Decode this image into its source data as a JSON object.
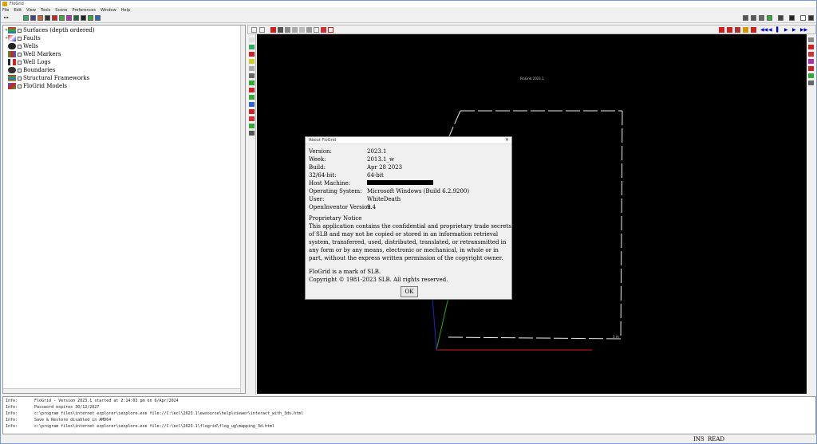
{
  "window": {
    "title": "FloGrid"
  },
  "menu": [
    "File",
    "Edit",
    "View",
    "Tools",
    "Scene",
    "Preferences",
    "Window",
    "Help"
  ],
  "tree": {
    "items": [
      {
        "label": "Surfaces (depth ordered)",
        "icon": "surfaces-icon",
        "expand": "+"
      },
      {
        "label": "Faults",
        "icon": "faults-icon",
        "expand": "+"
      },
      {
        "label": "Wells",
        "icon": "wells-icon",
        "expand": ""
      },
      {
        "label": "Well Markers",
        "icon": "well-markers-icon",
        "expand": ""
      },
      {
        "label": "Well Logs",
        "icon": "well-logs-icon",
        "expand": ""
      },
      {
        "label": "Boundaries",
        "icon": "boundaries-icon",
        "expand": ""
      },
      {
        "label": "Structural Frameworks",
        "icon": "structural-frameworks-icon",
        "expand": ""
      },
      {
        "label": "FloGrid Models",
        "icon": "flogrid-models-icon",
        "expand": ""
      }
    ]
  },
  "viewer": {
    "title": "FloGrid 2023.1",
    "corner_label": "3 m",
    "background": "#000000"
  },
  "about": {
    "title": "About FloGrid",
    "rows": [
      {
        "key": "Version:",
        "value": "2023.1"
      },
      {
        "key": "Week:",
        "value": "2013.1_w"
      },
      {
        "key": "Build:",
        "value": "Apr 28 2023"
      },
      {
        "key": "32/64-bit:",
        "value": "64-bit"
      },
      {
        "key": "Host Machine:",
        "value": ""
      },
      {
        "key": "Operating System:",
        "value": "Microsoft Windows (Build 6.2.9200)"
      },
      {
        "key": "User:",
        "value": "WhiteDeath"
      },
      {
        "key": "OpenInventor Version",
        "value": "9.4"
      }
    ],
    "notice_heading": "Proprietary Notice",
    "notice_body": "This application contains the confidential and proprietary trade secrets of SLB and may not be copied or stored in an information retrieval system, transferred, used, distributed, translated, or retransmitted in any form or by any means, electronic or mechanical, in whole or in part, without the express written permission of the copyright owner.",
    "trademark": "FloGrid is a mark of SLB.",
    "copyright": "Copyright © 1981-2023 SLB. All rights reserved.",
    "ok_label": "OK"
  },
  "log": [
    {
      "level": "Info:",
      "text": "FloGrid - Version 2023.1 started at 2:14:03 pm on 6/Apr/2024"
    },
    {
      "level": "Info:",
      "text": "Password expires 30/12/2027"
    },
    {
      "level": "Info:",
      "text": "c:\\program files\\internet explorer\\iexplore.exe file://C:\\ecl\\2023.1\\ewsource\\help\\viewer\\interact_with_3dv.html"
    },
    {
      "level": "Info:",
      "text": "Save & Restore disabled in AMD64"
    },
    {
      "level": "Info:",
      "text": "c:\\program files\\internet explorer\\iexplore.exe file://C:\\ecl\\2023.1\\flogrid\\flog_ug\\mapping_3d.html"
    }
  ],
  "status": {
    "ins": "INS",
    "read": "READ"
  },
  "colors": {
    "accent_red": "#cc0000",
    "accent_green": "#00aa00",
    "accent_blue": "#0000cc"
  }
}
